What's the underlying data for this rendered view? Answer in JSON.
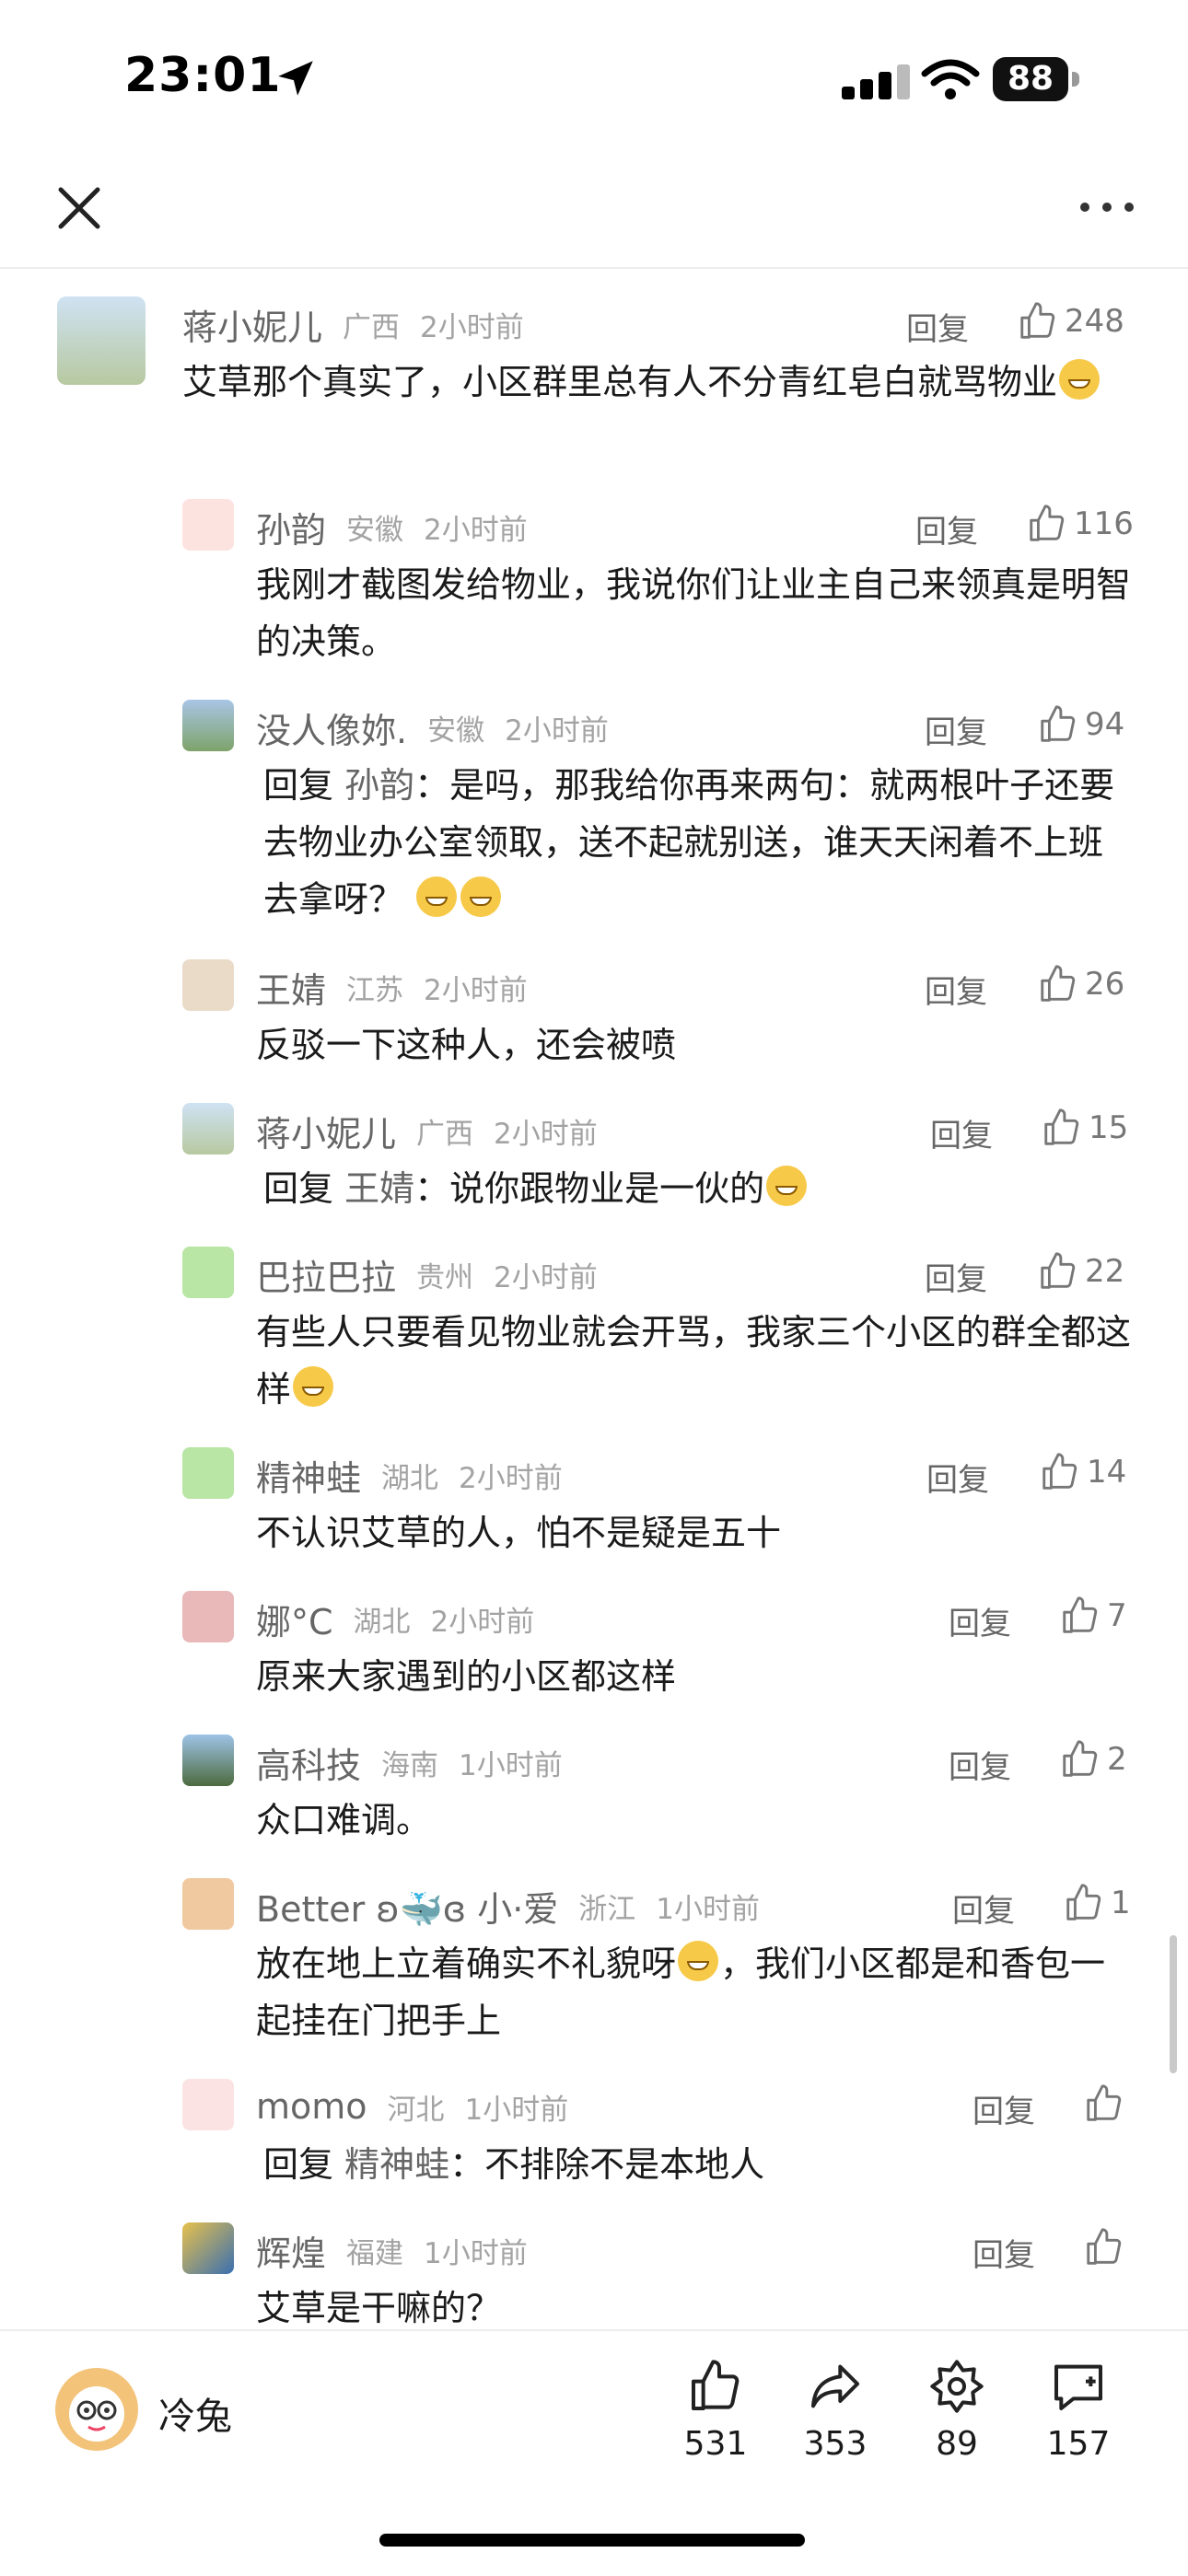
{
  "status_bar": {
    "time": "23:01",
    "battery": "88"
  },
  "comments": [
    {
      "name": "蒋小妮儿",
      "region": "广西",
      "time": "2小时前",
      "reply_label": "回复",
      "likes": "248",
      "text": "艾草那个真实了，小区群里总有人不分青红皂白就骂物业",
      "emoji_icon": "grinning-face"
    },
    {
      "name": "孙韵",
      "region": "安徽",
      "time": "2小时前",
      "reply_label": "回复",
      "likes": "116",
      "text": "我刚才截图发给物业，我说你们让业主自己来领真是明智的决策。"
    },
    {
      "name": "没人像妳.",
      "region": "安徽",
      "time": "2小时前",
      "reply_label": "回复",
      "likes": "94",
      "reply_prefix": "回复",
      "reply_to": "孙韵",
      "text": "：是吗，那我给你再来两句：就两根叶子还要去物业办公室领取，送不起就别送，谁天天闲着不上班去拿呀？",
      "emoji_icon": "face-palm-hands"
    },
    {
      "name": "王婧",
      "region": "江苏",
      "time": "2小时前",
      "reply_label": "回复",
      "likes": "26",
      "text": "反驳一下这种人，还会被喷"
    },
    {
      "name": "蒋小妮儿",
      "region": "广西",
      "time": "2小时前",
      "reply_label": "回复",
      "likes": "15",
      "reply_prefix": "回复",
      "reply_to": "王婧",
      "text": "：说你跟物业是一伙的",
      "emoji_icon": "grinning-face"
    },
    {
      "name": "巴拉巴拉",
      "region": "贵州",
      "time": "2小时前",
      "reply_label": "回复",
      "likes": "22",
      "text": "有些人只要看见物业就会开骂，我家三个小区的群全都这样",
      "emoji_icon": "pleading-face"
    },
    {
      "name": "精神蛙",
      "region": "湖北",
      "time": "2小时前",
      "reply_label": "回复",
      "likes": "14",
      "text": "不认识艾草的人，怕不是疑是五十"
    },
    {
      "name": "娜°C",
      "region": "湖北",
      "time": "2小时前",
      "reply_label": "回复",
      "likes": "7",
      "text": "原来大家遇到的小区都这样"
    },
    {
      "name": "高科技",
      "region": "海南",
      "time": "1小时前",
      "reply_label": "回复",
      "likes": "2",
      "text": "众口难调。"
    },
    {
      "name": "Better ʚ🐳ɞ 小·爱",
      "region": "浙江",
      "time": "1小时前",
      "reply_label": "回复",
      "likes": "1",
      "text": "放在地上立着确实不礼貌呀",
      "text2": "，我们小区都是和香包一起挂在门把手上",
      "emoji_icon": "unamused-face"
    },
    {
      "name": "momo",
      "region": "河北",
      "time": "1小时前",
      "reply_label": "回复",
      "likes": "",
      "reply_prefix": "回复",
      "reply_to": "精神蛙",
      "text": "：不排除不是本地人"
    },
    {
      "name": "辉煌",
      "region": "福建",
      "time": "1小时前",
      "reply_label": "回复",
      "likes": "",
      "text": "艾草是干嘛的？"
    }
  ],
  "bottom_bar": {
    "user_name": "冷兔",
    "likes": "531",
    "shares": "353",
    "favorites": "89",
    "comments": "157"
  },
  "colors": {
    "text_primary": "#1a1a1a",
    "text_secondary": "#666666",
    "text_muted": "#a3a3a3"
  }
}
